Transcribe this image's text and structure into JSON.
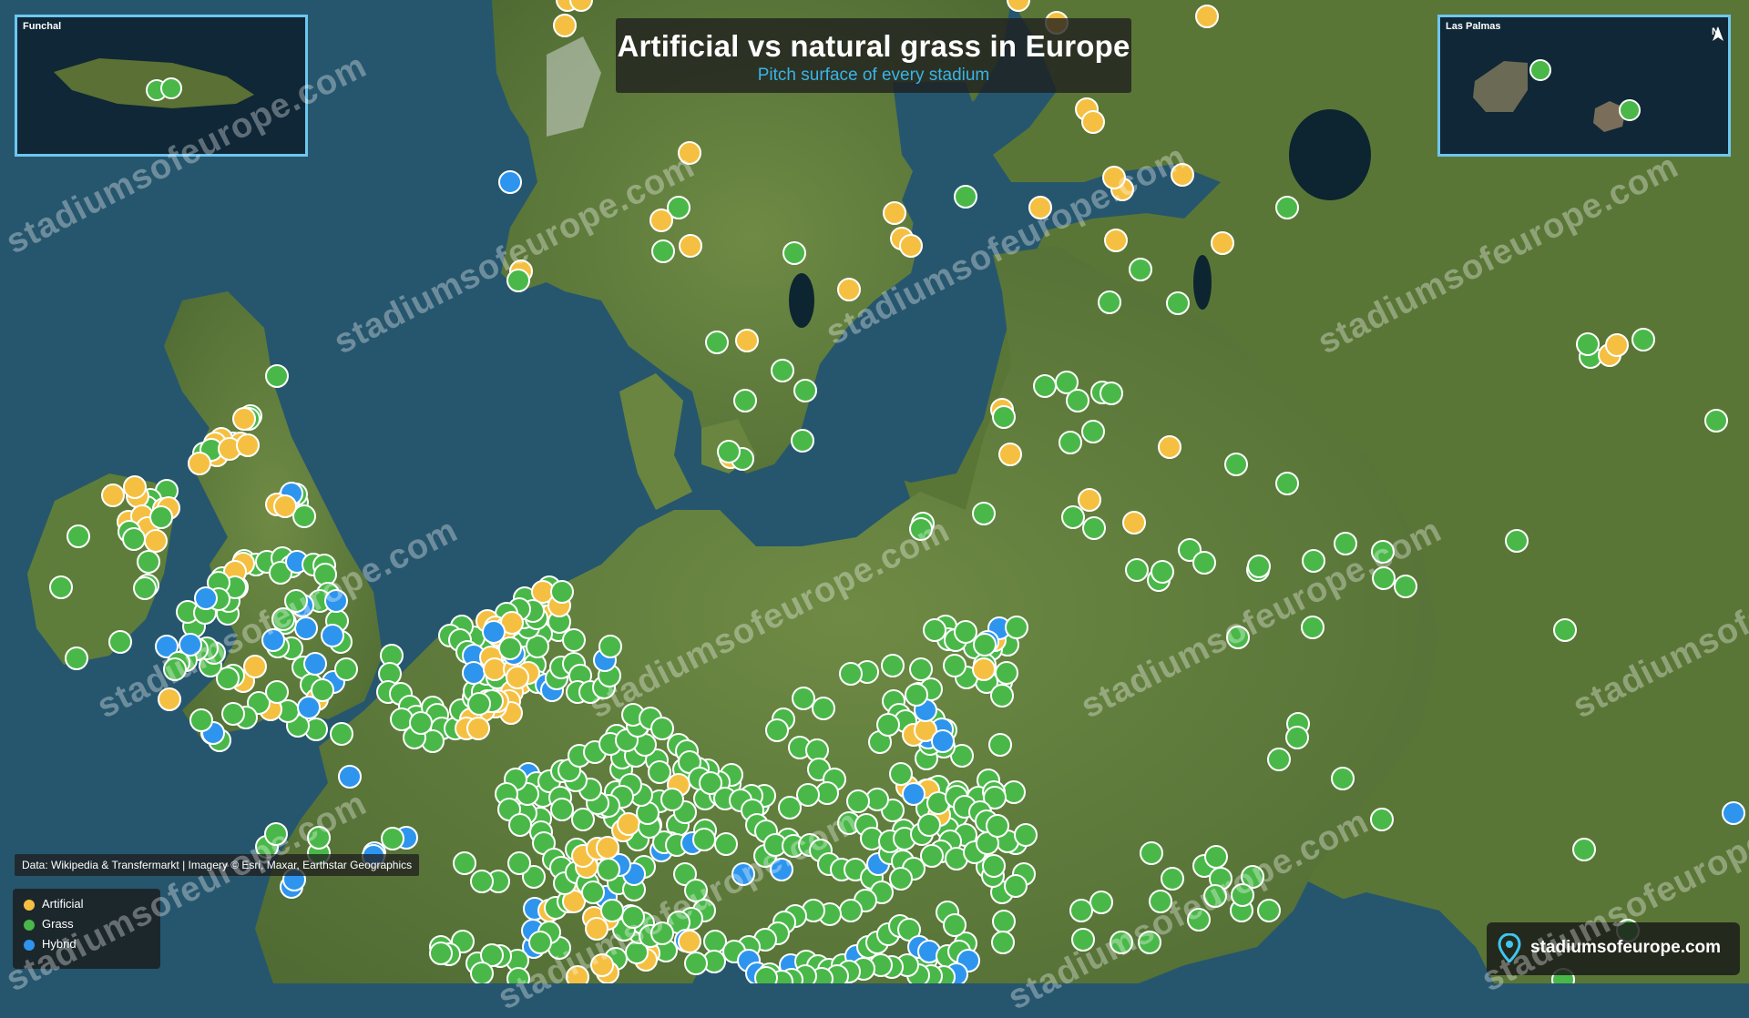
{
  "title": "Artificial vs natural grass in Europe",
  "subtitle": "Pitch surface of every stadium",
  "insets": {
    "funchal": "Funchal",
    "las_palmas": "Las Palmas",
    "north": "N"
  },
  "credits": {
    "data": "Data: Wikipedia & Transfermarkt",
    "imagery": "Imagery © Esri, Maxar, Earthstar Geographics"
  },
  "legend": [
    {
      "label": "Artificial",
      "color": "#f5c042"
    },
    {
      "label": "Grass",
      "color": "#49b848"
    },
    {
      "label": "Hybrid",
      "color": "#2e95ee"
    }
  ],
  "brand": "stadiumsofeurope.com",
  "watermark": "stadiumsofeurope.com",
  "colors": {
    "sea": "#26566e",
    "land_green": "#5c7a3a",
    "artificial": "#f5c042",
    "grass": "#49b848",
    "hybrid": "#2e95ee",
    "title_accent": "#3ab4e8",
    "inset_border": "#6ec6f0"
  },
  "icons": [
    "map-pin-icon",
    "north-arrow-icon"
  ]
}
